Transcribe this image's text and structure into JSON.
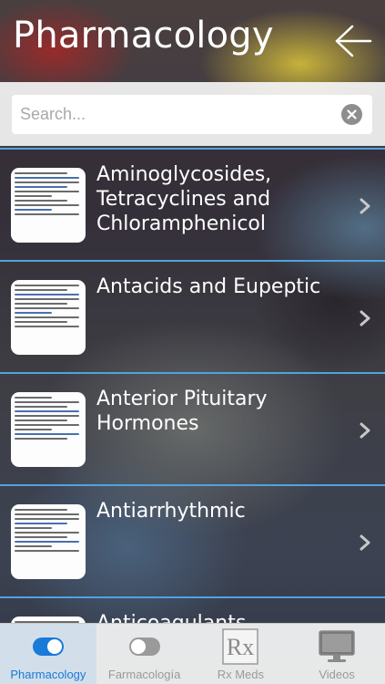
{
  "header": {
    "title": "Pharmacology",
    "back_icon": "back-arrow-icon"
  },
  "search": {
    "placeholder": "Search...",
    "value": "",
    "clear_icon": "clear-icon"
  },
  "list": {
    "items": [
      {
        "title": "Aminoglycosides, Tetracyclines and Chloramphenicol",
        "chevron_icon": "chevron-right-icon"
      },
      {
        "title": "Antacids and Eupeptic",
        "chevron_icon": "chevron-right-icon"
      },
      {
        "title": "Anterior Pituitary Hormones",
        "chevron_icon": "chevron-right-icon"
      },
      {
        "title": "Antiarrhythmic",
        "chevron_icon": "chevron-right-icon"
      },
      {
        "title": "Anticoagulants",
        "chevron_icon": "chevron-right-icon"
      }
    ]
  },
  "tabbar": {
    "tabs": [
      {
        "label": "Pharmacology",
        "icon": "toggle-on-icon",
        "active": true
      },
      {
        "label": "Farmacología",
        "icon": "toggle-off-icon",
        "active": false
      },
      {
        "label": "Rx Meds",
        "icon": "rx-icon",
        "active": false
      },
      {
        "label": "Videos",
        "icon": "monitor-icon",
        "active": false
      }
    ]
  },
  "colors": {
    "accent": "#1a7ad8",
    "separator": "#4fa3e0",
    "inactive_tab": "#9a9a9a"
  }
}
